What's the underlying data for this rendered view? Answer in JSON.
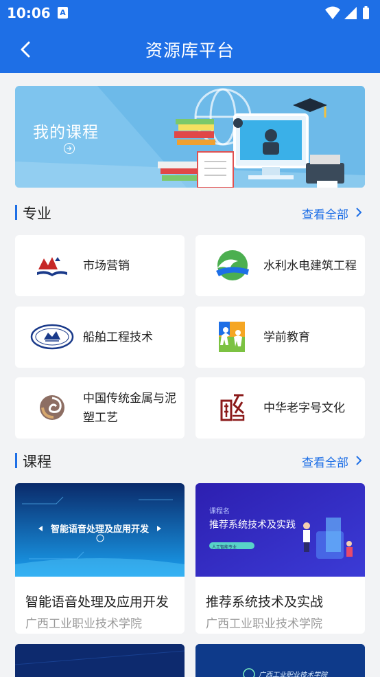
{
  "status": {
    "time": "10:06",
    "notification_badge": "A"
  },
  "header": {
    "title": "资源库平台"
  },
  "banner": {
    "title": "我的课程"
  },
  "majors_section": {
    "title": "专业",
    "view_all": "查看全部"
  },
  "majors": [
    {
      "label": "市场营销",
      "icon": "mountain-book-logo"
    },
    {
      "label": "水利水电建筑工程",
      "icon": "wave-logo"
    },
    {
      "label": "船舶工程技术",
      "icon": "ship-seal-logo"
    },
    {
      "label": "学前教育",
      "icon": "children-logo"
    },
    {
      "label": "中国传统金属与泥塑工艺",
      "icon": "swirl-logo"
    },
    {
      "label": "中华老字号文化",
      "icon": "seal-character-logo"
    }
  ],
  "courses_section": {
    "title": "课程",
    "view_all": "查看全部"
  },
  "courses": [
    {
      "name": "智能语音处理及应用开发",
      "school": "广西工业职业技术学院",
      "thumb_text": "智能语音处理及应用开发"
    },
    {
      "name": "推荐系统技术及实战",
      "school": "广西工业职业技术学院",
      "thumb_label": "课程名",
      "thumb_text": "推荐系统技术及实践",
      "thumb_tag": "人工智能专业"
    }
  ],
  "partial_courses": [
    {
      "thumb_text": ""
    },
    {
      "thumb_text": "广西工业职业技术学院"
    }
  ],
  "colors": {
    "primary": "#1e6fe6",
    "background": "#f2f3f5",
    "text": "#222222",
    "muted": "#999999"
  }
}
